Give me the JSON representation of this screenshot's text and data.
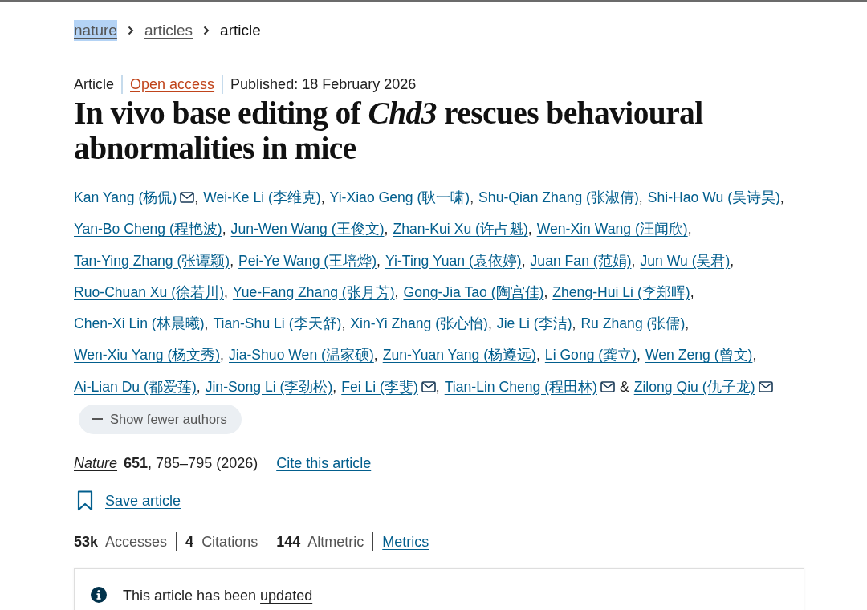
{
  "breadcrumbs": [
    {
      "label": "nature",
      "current": false,
      "highlighted": true
    },
    {
      "label": "articles",
      "current": false,
      "highlighted": false
    },
    {
      "label": "article",
      "current": true,
      "highlighted": false
    }
  ],
  "article_info": [
    {
      "label": "Article",
      "kind": "type"
    },
    {
      "label": "Open access",
      "kind": "access"
    },
    {
      "label": "Published: 18 February 2026",
      "kind": "date"
    }
  ],
  "title": "In vivo base editing of *Chd3* rescues behavioural abnormalities in mice",
  "authors": [
    {
      "name": "Kan Yang (杨侃)",
      "email": true,
      "separator": ","
    },
    {
      "name": "Wei-Ke Li (李维克)",
      "email": false,
      "separator": ","
    },
    {
      "name": "Yi-Xiao Geng (耿一啸)",
      "email": false,
      "separator": ","
    },
    {
      "name": "Shu-Qian Zhang (张淑倩)",
      "email": false,
      "separator": ","
    },
    {
      "name": "Shi-Hao Wu (吴诗昊)",
      "email": false,
      "separator": ","
    },
    {
      "name": "Yan-Bo Cheng (程艳波)",
      "email": false,
      "separator": ","
    },
    {
      "name": "Jun-Wen Wang (王俊文)",
      "email": false,
      "separator": ","
    },
    {
      "name": "Zhan-Kui Xu (许占魁)",
      "email": false,
      "separator": ","
    },
    {
      "name": "Wen-Xin Wang (汪闻欣)",
      "email": false,
      "separator": ","
    },
    {
      "name": "Tan-Ying Zhang (张谭颖)",
      "email": false,
      "separator": ","
    },
    {
      "name": "Pei-Ye Wang (王培烨)",
      "email": false,
      "separator": ","
    },
    {
      "name": "Yi-Ting Yuan (袁依婷)",
      "email": false,
      "separator": ","
    },
    {
      "name": "Juan Fan (范娟)",
      "email": false,
      "separator": ","
    },
    {
      "name": "Jun Wu (吴君)",
      "email": false,
      "separator": ","
    },
    {
      "name": "Ruo-Chuan Xu (徐若川)",
      "email": false,
      "separator": ","
    },
    {
      "name": "Yue-Fang Zhang (张月芳)",
      "email": false,
      "separator": ","
    },
    {
      "name": "Gong-Jia Tao (陶宫佳)",
      "email": false,
      "separator": ","
    },
    {
      "name": "Zheng-Hui Li (李郑晖)",
      "email": false,
      "separator": ","
    },
    {
      "name": "Chen-Xi Lin (林晨曦)",
      "email": false,
      "separator": ","
    },
    {
      "name": "Tian-Shu Li (李天舒)",
      "email": false,
      "separator": ","
    },
    {
      "name": "Xin-Yi Zhang (张心怡)",
      "email": false,
      "separator": ","
    },
    {
      "name": "Jie Li (李洁)",
      "email": false,
      "separator": ","
    },
    {
      "name": "Ru Zhang (张儒)",
      "email": false,
      "separator": ","
    },
    {
      "name": "Wen-Xiu Yang (杨文秀)",
      "email": false,
      "separator": ","
    },
    {
      "name": "Jia-Shuo Wen (温家硕)",
      "email": false,
      "separator": ","
    },
    {
      "name": "Zun-Yuan Yang (杨遵远)",
      "email": false,
      "separator": ","
    },
    {
      "name": "Li Gong (龚立)",
      "email": false,
      "separator": ","
    },
    {
      "name": "Wen Zeng (曾文)",
      "email": false,
      "separator": ","
    },
    {
      "name": "Ai-Lian Du (都爱莲)",
      "email": false,
      "separator": ","
    },
    {
      "name": "Jin-Song Li (李劲松)",
      "email": false,
      "separator": ","
    },
    {
      "name": "Fei Li (李斐)",
      "email": true,
      "separator": ","
    },
    {
      "name": "Tian-Lin Cheng (程田林)",
      "email": true,
      "conjunction": "&"
    },
    {
      "name": "Zilong Qiu (仇子龙)",
      "email": true
    }
  ],
  "show_fewer_button": "Show fewer authors",
  "citation": {
    "journal": "Nature",
    "details": "**651**, 785–795 (2026)",
    "cite_link": "Cite this article"
  },
  "save_link": "Save article",
  "metrics": [
    {
      "count": "53k",
      "name": "Accesses"
    },
    {
      "count": "4",
      "name": "Citations"
    },
    {
      "count": "144",
      "name": "Altmetric"
    }
  ],
  "metrics_link": "Metrics",
  "notice": {
    "text": "This article has been",
    "link": "updated"
  }
}
